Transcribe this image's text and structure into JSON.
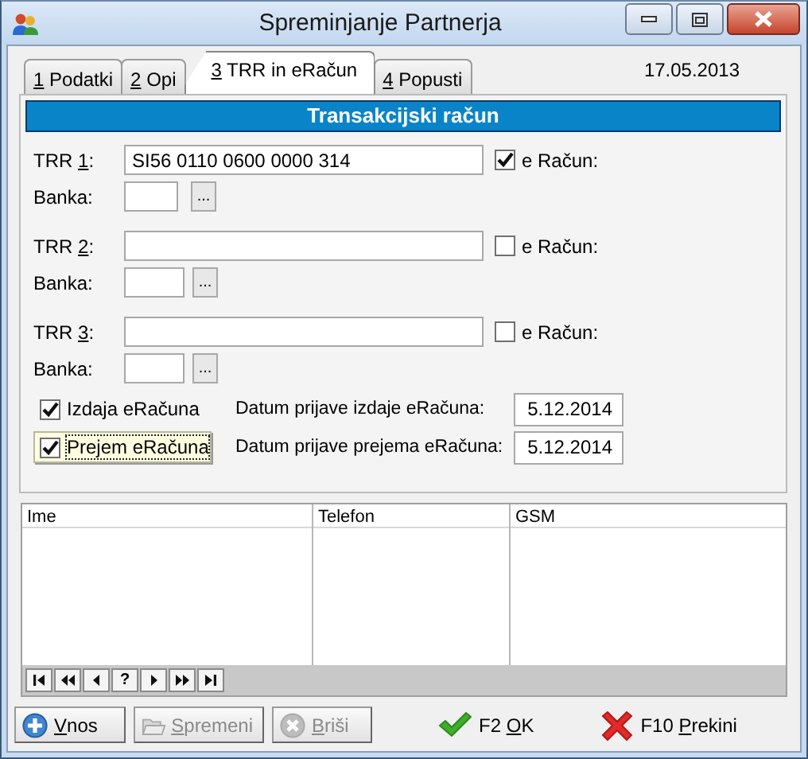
{
  "window": {
    "title": "Spreminjanje Partnerja"
  },
  "tabs": [
    {
      "key": "1",
      "after": " Podatki",
      "selected": false
    },
    {
      "key": "2",
      "after": " Opi",
      "selected": false
    },
    {
      "key": "3",
      "after": " TRR in eRačun",
      "selected": true
    },
    {
      "key": "4",
      "after": " Popusti",
      "selected": false
    }
  ],
  "date": "17.05.2013",
  "section_title": "Transakcijski račun",
  "accounts": [
    {
      "label": {
        "before": "TRR ",
        "key": "1",
        "after": ":"
      },
      "value": "SI56 0110 0600 0000 314",
      "e_racun_label": "e Račun:",
      "e_racun": true,
      "bank_label": "Banka:",
      "bank_button": "..."
    },
    {
      "label": {
        "before": "TRR ",
        "key": "2",
        "after": ":"
      },
      "e_racun_label": "e Račun:",
      "e_racun": false,
      "bank_label": "Banka:",
      "bank_button": "..."
    },
    {
      "label": {
        "before": "TRR ",
        "key": "3",
        "after": ":"
      },
      "e_racun_label": "e Račun:",
      "e_racun": false,
      "bank_label": "Banka:",
      "bank_button": "..."
    }
  ],
  "options": [
    {
      "label": "Izdaja eRačuna",
      "checked": true,
      "focused": false,
      "date_label": "Datum prijave izdaje eRačuna:",
      "date": "5.12.2014"
    },
    {
      "label": "Prejem eRačuna",
      "checked": true,
      "focused": true,
      "date_label": "Datum prijave prejema eRačuna:",
      "date": "5.12.2014"
    }
  ],
  "grid": {
    "columns": [
      "Ime",
      "Telefon",
      "GSM"
    ],
    "navigator": [
      {
        "kind": "first"
      },
      {
        "kind": "prior-page"
      },
      {
        "kind": "prior"
      },
      {
        "kind": "help",
        "text": "?"
      },
      {
        "kind": "next"
      },
      {
        "kind": "next-page"
      },
      {
        "kind": "last"
      }
    ]
  },
  "buttons": [
    {
      "kind": "add",
      "key": "V",
      "after": "nos",
      "disabled": false
    },
    {
      "kind": "edit",
      "key": "S",
      "after": "premeni",
      "disabled": true
    },
    {
      "kind": "delete",
      "key": "B",
      "after": "riši",
      "disabled": true
    },
    {
      "kind": "ok",
      "before": "F2 ",
      "key": "O",
      "after": "K",
      "disabled": false
    },
    {
      "kind": "cancel",
      "before": "F10 ",
      "key": "P",
      "after": "rekini",
      "disabled": false
    }
  ]
}
